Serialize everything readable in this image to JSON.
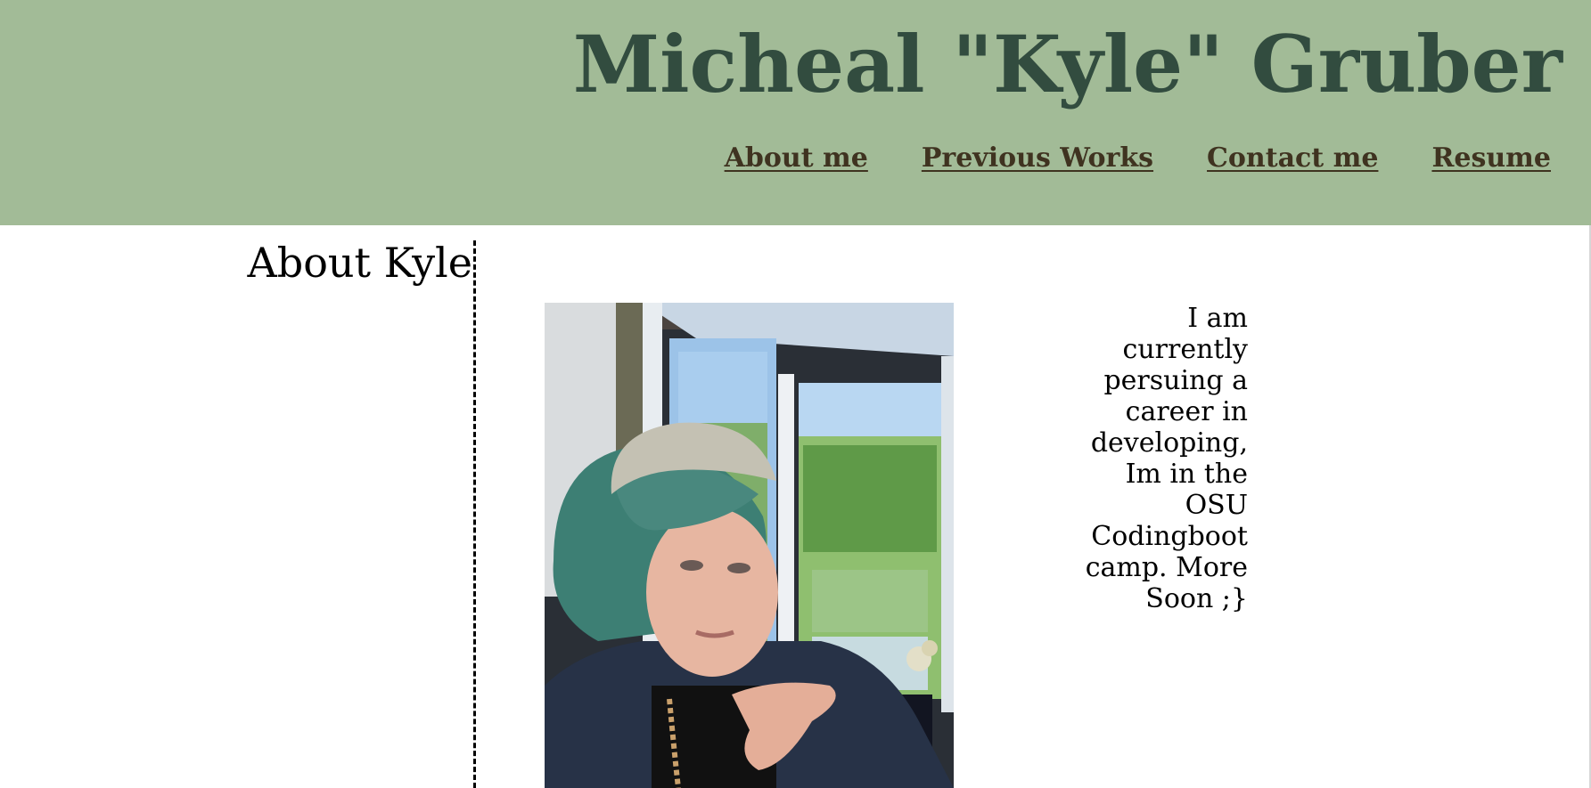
{
  "header": {
    "title": "Micheal \"Kyle\" Gruber",
    "background_color": "#a2bb97",
    "title_color": "#324c3f",
    "nav_color": "#3f3320",
    "nav": [
      {
        "label": "About me"
      },
      {
        "label": "Previous Works"
      },
      {
        "label": "Contact me"
      },
      {
        "label": "Resume"
      }
    ]
  },
  "about": {
    "heading": "About Kyle",
    "photo_icon": "portrait-photo",
    "text": "I am currently persuing a career in developing, Im in the OSU Codingboot camp. More Soon ;}"
  }
}
